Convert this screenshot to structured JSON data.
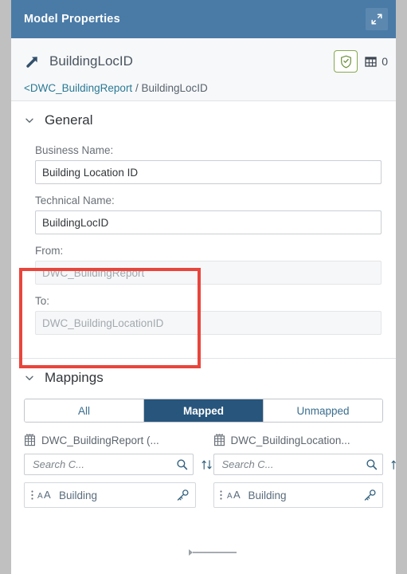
{
  "titlebar": {
    "title": "Model Properties",
    "expand_icon": "expand-icon"
  },
  "object_header": {
    "icon": "association-arrow-icon",
    "name": "BuildingLocID",
    "shield_icon": "shield-check-icon",
    "grid_icon": "table-grid-icon",
    "grid_count": "0",
    "breadcrumb": {
      "parent_link": "<DWC_BuildingReport",
      "separator": "/",
      "current": "BuildingLocID"
    }
  },
  "general": {
    "title": "General",
    "collapse_icon": "chevron-down-icon",
    "business_name_label": "Business Name:",
    "business_name_value": "Building Location ID",
    "business_name_placeholder": "",
    "technical_name_label": "Technical Name:",
    "technical_name_value": "BuildingLocID",
    "technical_name_placeholder": "",
    "from_label": "From:",
    "from_value": "DWC_BuildingReport",
    "to_label": "To:",
    "to_value": "DWC_BuildingLocationID",
    "highlight_color": "#e8453c"
  },
  "mappings": {
    "title": "Mappings",
    "collapse_icon": "chevron-down-icon",
    "filters": [
      {
        "label": "All",
        "active": false
      },
      {
        "label": "Mapped",
        "active": true
      },
      {
        "label": "Unmapped",
        "active": false
      }
    ],
    "source": {
      "icon": "table-columns-icon",
      "header": "DWC_BuildingReport (...",
      "search_placeholder": "Search C...",
      "search_value": "",
      "search_icon": "search-icon",
      "sort_icon": "sort-icon",
      "items": [
        {
          "drag_icon": "drag-dots-icon",
          "type_icon": "text-type-icon",
          "label": "Building",
          "key_icon": "key-icon"
        }
      ]
    },
    "target": {
      "icon": "table-columns-icon",
      "header": "DWC_BuildingLocation...",
      "search_placeholder": "Search C...",
      "search_value": "",
      "search_icon": "search-icon",
      "sort_icon": "sort-icon",
      "items": [
        {
          "drag_icon": "drag-dots-icon",
          "type_icon": "text-type-icon",
          "label": "Building",
          "key_icon": "key-icon"
        }
      ]
    },
    "connector_icon": "mapping-connector-line"
  },
  "colors": {
    "titlebar_bg": "#4a7ba7",
    "segment_active_bg": "#27557c",
    "link": "#2a7a94",
    "highlight": "#e8453c",
    "page_bg": "#c0c0c0"
  }
}
